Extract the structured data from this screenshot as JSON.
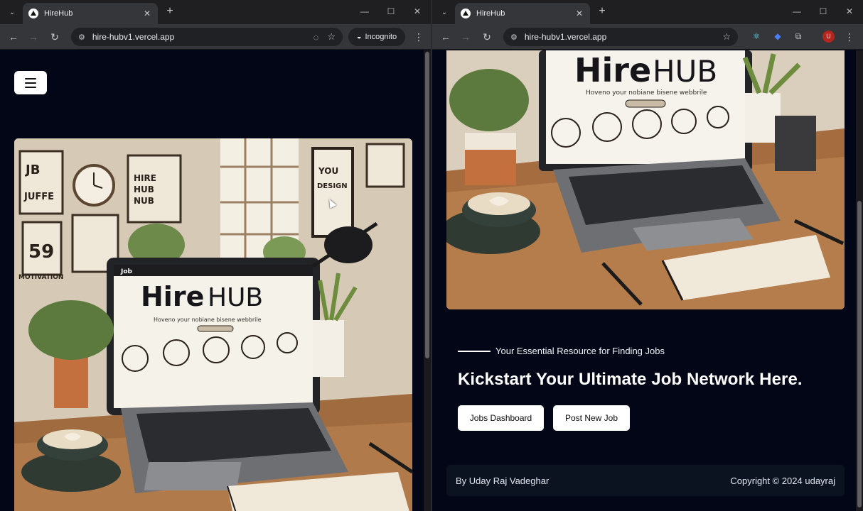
{
  "windows": [
    {
      "tab": {
        "title": "HireHub"
      },
      "url": "hire-hubv1.vercel.app",
      "incognito_label": "Incognito"
    },
    {
      "tab": {
        "title": "HireHub"
      },
      "url": "hire-hubv1.vercel.app",
      "profile_initial": "U"
    }
  ],
  "icons": {
    "tab_search": "chevron-down-icon",
    "new_tab": "plus-icon",
    "back": "arrow-left-icon",
    "forward": "arrow-right-icon",
    "reload": "reload-icon",
    "site_info": "tune-icon",
    "eye_off": "eye-off-icon",
    "bookmark": "star-icon",
    "menu": "hamburger-icon"
  },
  "page": {
    "tagline": "Your Essential Resource for Finding Jobs",
    "headline": "Kickstart Your Ultimate Job Network Here.",
    "buttons": {
      "jobs_dashboard": "Jobs Dashboard",
      "post_new_job": "Post New Job"
    },
    "footer": {
      "author": "By Uday Raj Vadeghar",
      "copyright": "Copyright © 2024 udayraj"
    }
  },
  "hero_image_text": {
    "brand_light": "Hire",
    "brand_bold": "HUB",
    "subtitle": "Hoveno your nobiane bisene webbrile",
    "nav_logo": "Job",
    "poster_1": "HIRE HUB NUB",
    "poster_2": "59",
    "poster_3": "YOU DESIGN",
    "poster_4": "JUFFE",
    "poster_5": "MOTIVATION"
  },
  "colors": {
    "page_bg": "#020617",
    "footer_bg": "#0b1220",
    "button_bg": "#ffffff",
    "chrome_tab": "#35363a",
    "profile_avatar": "#b3261e"
  }
}
